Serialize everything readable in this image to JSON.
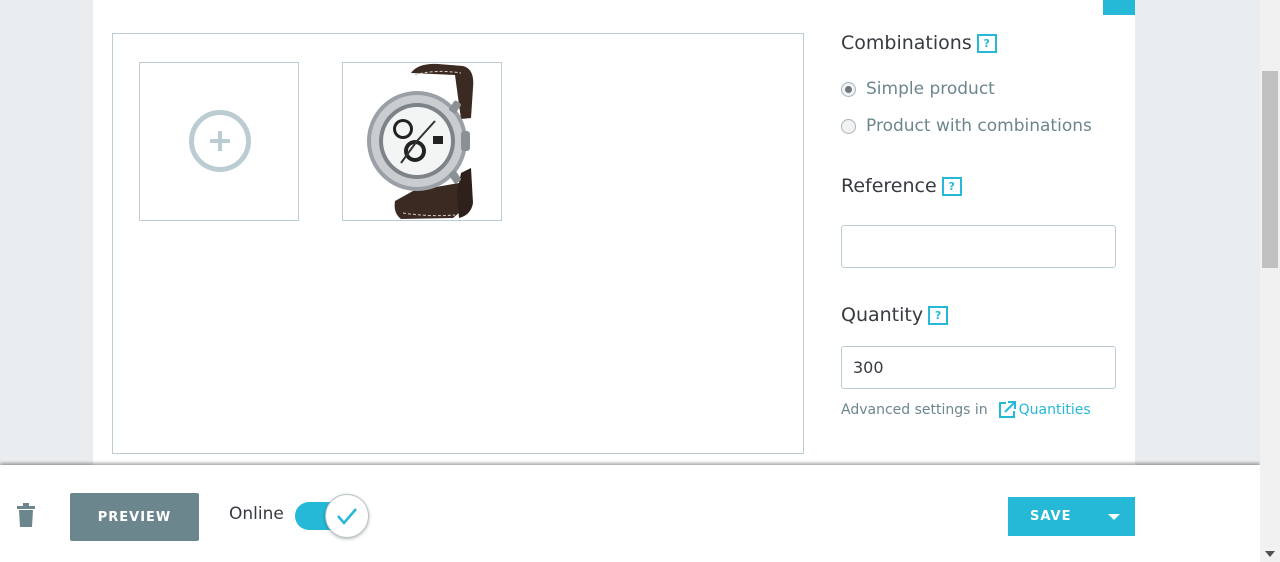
{
  "images": {
    "add_icon": "plus-circle-icon",
    "photo_icon": "watch-product-image"
  },
  "combinations": {
    "title": "Combinations",
    "help": "?",
    "options": [
      {
        "label": "Simple product",
        "checked": true
      },
      {
        "label": "Product with combinations",
        "checked": false
      }
    ]
  },
  "reference": {
    "title": "Reference",
    "help": "?",
    "value": ""
  },
  "quantity": {
    "title": "Quantity",
    "help": "?",
    "value": "300",
    "advanced_text": "Advanced settings in",
    "advanced_link": "Quantities"
  },
  "footer": {
    "delete_icon": "trash-icon",
    "preview_label": "PREVIEW",
    "online_label": "Online",
    "online_enabled": true,
    "save_label": "SAVE",
    "save_menu_icon": "caret-down-icon"
  },
  "colors": {
    "accent": "#25b9d7",
    "preview_button": "#6c868e",
    "border": "#bbcdd2"
  }
}
